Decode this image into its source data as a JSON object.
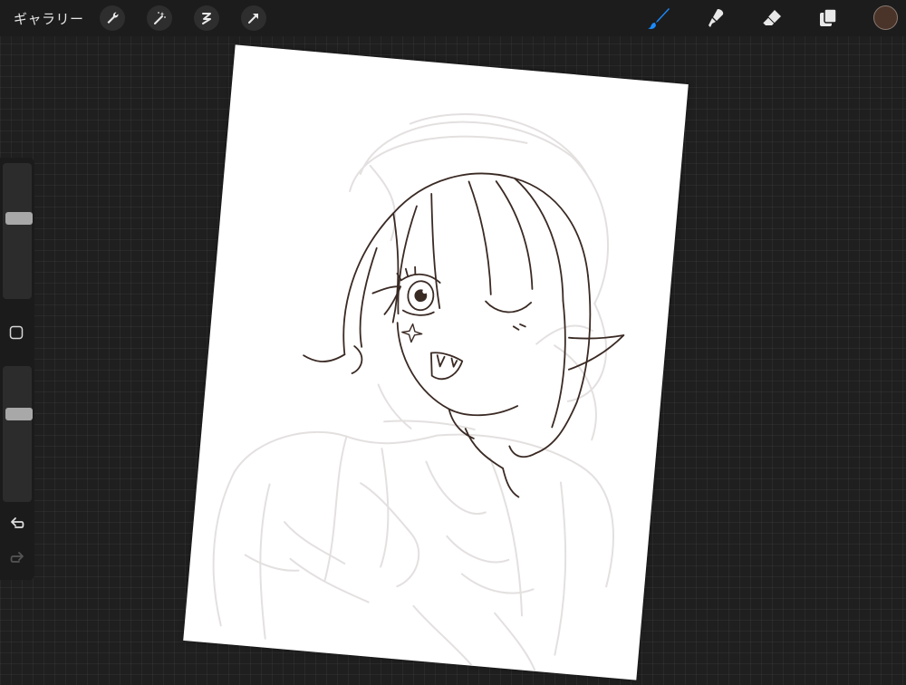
{
  "app": {
    "gallery_label": "ギャラリー"
  },
  "toolbar_left": [
    {
      "name": "actions-wrench-icon"
    },
    {
      "name": "adjustments-magic-wand-icon"
    },
    {
      "name": "selection-icon"
    },
    {
      "name": "transform-arrow-icon"
    }
  ],
  "toolbar_right": [
    {
      "name": "brush-icon",
      "active": true,
      "color": "#1a8cff"
    },
    {
      "name": "smudge-icon",
      "active": false
    },
    {
      "name": "eraser-icon",
      "active": false
    },
    {
      "name": "layers-icon",
      "active": false
    }
  ],
  "current_color": "#4a3328",
  "sidebar": {
    "brush_size_level": 0.6,
    "opacity_level": 0.66
  },
  "canvas": {
    "line_color": "#3a2a24",
    "sketch_color": "#e6e3e3"
  }
}
